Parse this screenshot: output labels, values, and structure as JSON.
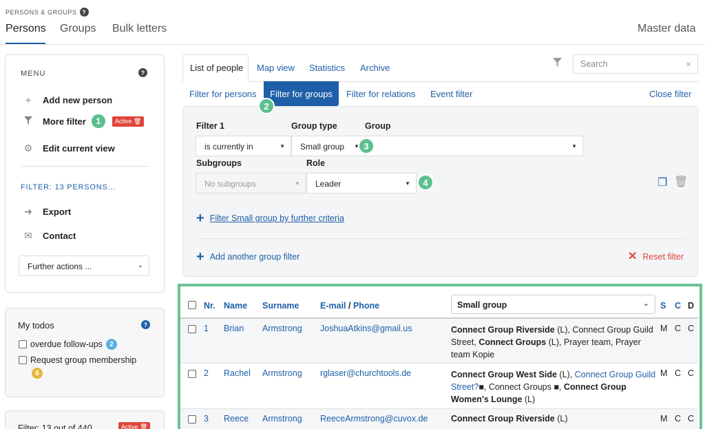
{
  "breadcrumb": "PERSONS & GROUPS",
  "top_tabs": [
    "Persons",
    "Groups",
    "Bulk letters"
  ],
  "master_data": "Master data",
  "menu": {
    "title": "MENU",
    "add_new_person": "Add new person",
    "more_filter": "More filter",
    "more_filter_badge": "1",
    "active_label": "Active",
    "edit_current_view": "Edit current view",
    "filter_heading": "FILTER: 13 PERSONS...",
    "export": "Export",
    "contact": "Contact",
    "further_actions": "Further actions ..."
  },
  "todos": {
    "title": "My todos",
    "items": [
      {
        "label": "overdue follow-ups",
        "count": "2"
      },
      {
        "label": "Request group membership",
        "count": "6"
      }
    ]
  },
  "bottom_card": {
    "text": "Filter: 13 out of 440",
    "active": "Active"
  },
  "view_tabs": [
    "List of people",
    "Map view",
    "Statistics",
    "Archive"
  ],
  "search_placeholder": "Search",
  "filter_links": [
    "Filter for persons",
    "Filter for groups",
    "Filter for relations",
    "Event filter"
  ],
  "close_filter": "Close filter",
  "annotation_badges": [
    "2",
    "3",
    "4"
  ],
  "filter_form": {
    "filter_label": "Filter 1",
    "group_type_label": "Group type",
    "group_label": "Group",
    "filter_value": "is currently in",
    "group_type_value": "Small group",
    "group_value": "",
    "subgroups_label": "Subgroups",
    "role_label": "Role",
    "subgroups_value": "No subgroups",
    "role_value": "Leader",
    "further_criteria": "Filter Small group by further criteria",
    "add_group_filter": "Add another group filter",
    "reset_filter": "Reset filter"
  },
  "table": {
    "col_nr": "Nr.",
    "col_name": "Name",
    "col_surname": "Surname",
    "col_email": "E-mail",
    "col_phone": "Phone",
    "col_group_select": "Small group",
    "col_s": "S",
    "col_c": "C",
    "col_d": "D",
    "rows": [
      {
        "nr": "1",
        "name": "Brian",
        "surname": "Armstrong",
        "email": "JoshuaAtkins@gmail.us",
        "g1": "Connect Group Riverside",
        "g1s": " (L), ",
        "g2": "Connect Group Guild Street",
        "g2s": ", ",
        "g3": "Connect Groups",
        "g3s": " (L), Prayer team, Prayer team Kopie",
        "s": "M",
        "c": "C",
        "d": "C"
      },
      {
        "nr": "2",
        "name": "Rachel",
        "surname": "Armstrong",
        "email": "rglaser@churchtools.de",
        "g1": "Connect Group West Side",
        "g1s": " (L), ",
        "g2": "Connect Group Guild Street?",
        "g2s": ", Connect Groups ",
        "g3": "Connect Group Women's Lounge",
        "g3s": " (L)",
        "s": "M",
        "c": "C",
        "d": "C"
      },
      {
        "nr": "3",
        "name": "Reece",
        "surname": "Armstrong",
        "email": "ReeceArmstrong@cuvox.de",
        "g1": "Connect Group Riverside",
        "g1s": " (L)",
        "s": "M",
        "c": "C",
        "d": "C"
      }
    ]
  },
  "colors": {
    "accent": "#1e5fa8",
    "green": "#5cc08e",
    "red": "#e0453a",
    "yellow": "#e8b53b"
  }
}
